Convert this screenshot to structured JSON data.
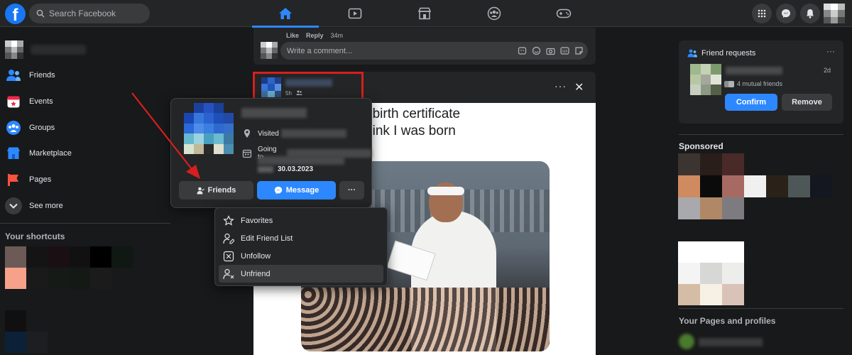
{
  "topbar": {
    "logo_letter": "f",
    "search_placeholder": "Search Facebook",
    "nav": [
      "home-icon",
      "watch-icon",
      "marketplace-icon",
      "groups-icon",
      "gaming-icon"
    ],
    "actions": [
      "menu-icon",
      "messenger-icon",
      "notifications-icon"
    ]
  },
  "sidebar": {
    "items": [
      {
        "label": "Friends",
        "icon": "friends-icon",
        "color": "#2d88ff"
      },
      {
        "label": "Events",
        "icon": "events-icon",
        "color": "#f02849"
      },
      {
        "label": "Groups",
        "icon": "groups-icon",
        "color": "#2d88ff"
      },
      {
        "label": "Marketplace",
        "icon": "marketplace-icon",
        "color": "#2d88ff"
      },
      {
        "label": "Pages",
        "icon": "pages-icon",
        "color": "#f7533e"
      },
      {
        "label": "See more",
        "icon": "chevron-down-icon",
        "color": "#e4e6eb"
      }
    ],
    "shortcuts_title": "Your shortcuts"
  },
  "comment": {
    "like_label": "Like",
    "reply_label": "Reply",
    "time": "34m",
    "placeholder": "Write a comment..."
  },
  "post": {
    "time": "5h",
    "text_line1": "g at my birth certificate",
    "text_line2": "eople think I was born"
  },
  "hover_card": {
    "visited_label": "Visited",
    "going_label": "Going to",
    "date": "30.03.2023",
    "friends_label": "Friends",
    "message_label": "Message",
    "more_label": "···"
  },
  "dropdown": {
    "items": [
      {
        "label": "Favorites",
        "icon": "star-icon"
      },
      {
        "label": "Edit Friend List",
        "icon": "edit-friend-list-icon"
      },
      {
        "label": "Unfollow",
        "icon": "unfollow-icon"
      },
      {
        "label": "Unfriend",
        "icon": "unfriend-icon"
      }
    ]
  },
  "friend_requests": {
    "title": "Friend requests",
    "age": "2d",
    "mutual": "4 mutual friends",
    "confirm_label": "Confirm",
    "remove_label": "Remove"
  },
  "right": {
    "sponsored_title": "Sponsored",
    "pages_title": "Your Pages and profiles"
  },
  "colors": {
    "accent": "#2d88ff",
    "bg": "#18191a",
    "surface": "#242526",
    "annotation": "#d71f1f"
  }
}
